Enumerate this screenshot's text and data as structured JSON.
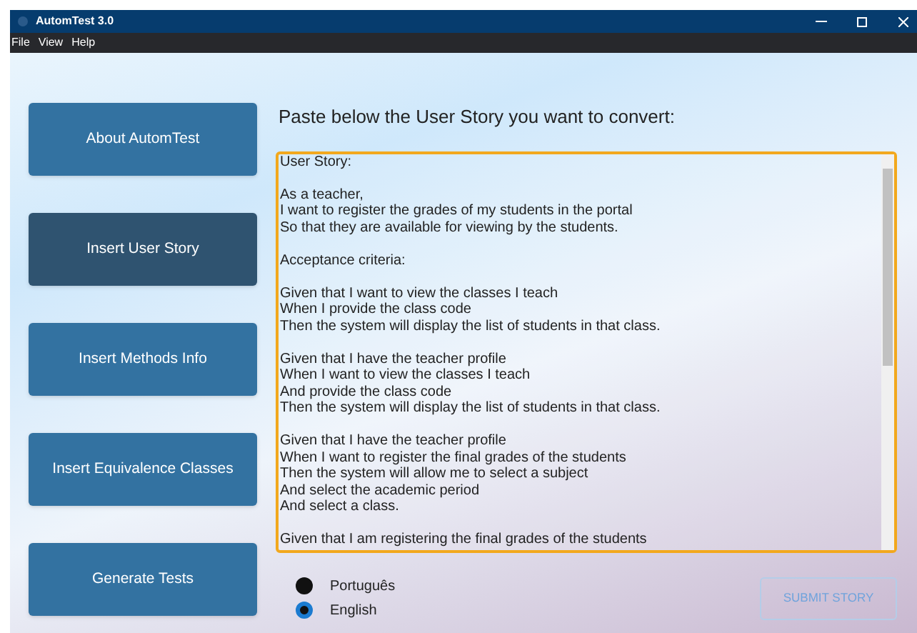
{
  "window": {
    "title": "AutomTest 3.0"
  },
  "menu": [
    "File",
    "View",
    "Help"
  ],
  "nav": [
    {
      "label": "About AutomTest",
      "selected": false
    },
    {
      "label": "Insert User Story",
      "selected": true
    },
    {
      "label": "Insert Methods Info",
      "selected": false
    },
    {
      "label": "Insert Equivalence Classes",
      "selected": false
    },
    {
      "label": "Generate Tests",
      "selected": false
    }
  ],
  "heading": "Paste below the User Story you want to convert:",
  "story": {
    "value": "User Story:\n\nAs a teacher,\nI want to register the grades of my students in the portal\nSo that they are available for viewing by the students.\n\nAcceptance criteria:\n\nGiven that I want to view the classes I teach\nWhen I provide the class code\nThen the system will display the list of students in that class.\n\nGiven that I have the teacher profile\nWhen I want to view the classes I teach\nAnd provide the class code\nThen the system will display the list of students in that class.\n\nGiven that I have the teacher profile\nWhen I want to register the final grades of the students\nThen the system will allow me to select a subject\nAnd select the academic period\nAnd select a class.\n\nGiven that I am registering the final grades of the students"
  },
  "languages": [
    {
      "label": "Português",
      "selected": false
    },
    {
      "label": "English",
      "selected": true
    }
  ],
  "submit": "SUBMIT STORY"
}
